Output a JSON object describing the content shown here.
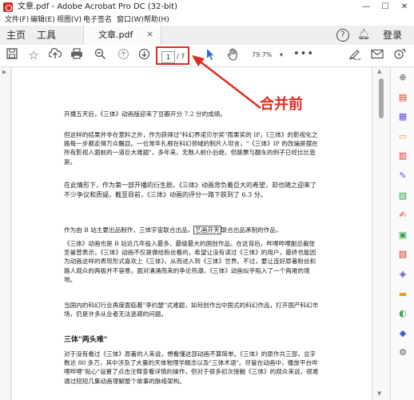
{
  "window": {
    "title": "文章.pdf - Adobe Acrobat Pro DC (32-bit)",
    "minimize": "—",
    "maximize": "☐",
    "close": "✕"
  },
  "menu": [
    "文件(F)",
    "编辑(E)",
    "视图(V)",
    "电子签名",
    "窗口(W)",
    "帮助(H)"
  ],
  "tabs": {
    "home": "主页",
    "tools": "工具",
    "doc": "文章.pdf",
    "close": "×",
    "help": "?",
    "signin": "登录"
  },
  "toolbar": {
    "page_current": "1",
    "page_total": "/ 7",
    "zoom": "79.7%",
    "zoom_caret": "▾",
    "more": "•••",
    "icons": [
      "save-icon",
      "bookmark-star-icon",
      "upload-cloud-icon",
      "print-icon",
      "zoom-out-icon",
      "page-up-icon",
      "page-down-icon",
      "select-cursor-icon",
      "hand-icon",
      "sign-pen-icon",
      "email-icon",
      "share-link-icon"
    ]
  },
  "annotation": {
    "label": "合并前",
    "color": "#e02b20"
  },
  "document": {
    "paragraphs": [
      "开播五天后，《三体》动画版迎来了豆瓣开分 7.2 分的成绩。",
      "但这样的结果并非在意料之外，作为获得过\"科幻界诺贝尔奖\"雨果奖的 IP，《三体》的影视化之路每一步都走得万众瞩目。一位常年扎根在科幻领域的制片人坦言，\"《三体》IP 的改编是摆在所有影视人面前的一道巨大难题\"，多年来，无数人前仆后继，但跳票与翻车的例子已经比比皆是。",
      "在此情形下，作为第一部开播的衍生剧，《三体》动画背负着巨大的希望，却也随之迎来了不少争议和质疑。截至目前，《三体》动画的评分一路下跌到了 6.3 分。",
      "作为由 B 站主要出品制作，三体宇宙联合出品，艺画开天联合出品承制的作品，",
      "《三体》动画也是 B 站近几年投入最多、最级最大的国创作品。在这背后，哔哩哔哩副总裁张圣晏曾表示，《三体》动画不仅是做给粉丝看的，希望让没有读过《三体》的用户，最终也能因为动画这样的表现形式喜欢上《三体》，从而进入到《三体》世界。不过，要让连好原著粉丝和路人观众的两极并不容易，面对涌涌而来的争论热潮，《三体》动画似乎陷入了一个两难的境地。",
      "当国内的科幻行业再度面临着\"李约瑟\"式难题，如何创作出中国式的科幻作品，打开国产科幻市场，仍是许多从业者无法逃避的问题。",
      "对于没有看过《三体》原著的人来说，想看懂这部动画不算简单。《三体》的原作共三部，总字数达 80 多万，其中涉及了大量的天体物理学概念以及\"三体术语\"。尽管在动画中，播放平台哔哩哔哩\"贴心\"设置了点击注释查看详情的操作，但对于很多初次接触《三体》的观众来说，很难通过短短几集动画理解整个故事的脉络架构。"
    ],
    "boxed_phrase": "艺画开天",
    "para4_prefix": "作为由 B 站主要出品制作，三体宇宙联合出品，",
    "para4_suffix": "联合出品承制的作品，",
    "heading": "三体\"两头难\""
  },
  "right_panel": {
    "icons": [
      {
        "name": "search-doc-icon",
        "glyph": "⊕",
        "color": "#5a5a5a"
      },
      {
        "name": "export-pdf-icon",
        "glyph": "▤",
        "color": "#d9362b"
      },
      {
        "name": "create-pdf-icon",
        "glyph": "▦",
        "color": "#6b4fd6"
      },
      {
        "name": "comment-icon",
        "glyph": "▭",
        "color": "#e7a21b"
      },
      {
        "name": "combine-files-icon",
        "glyph": "▥",
        "color": "#d9362b"
      },
      {
        "name": "edit-pdf-icon",
        "glyph": "✎",
        "color": "#6b4fd6"
      },
      {
        "name": "organize-pages-icon",
        "glyph": "▧",
        "color": "#2ba84a"
      },
      {
        "name": "fill-sign-icon",
        "glyph": "✍",
        "color": "#d9362b"
      },
      {
        "name": "send-review-icon",
        "glyph": "▣",
        "color": "#2ba84a"
      },
      {
        "name": "compress-pdf-icon",
        "glyph": "▨",
        "color": "#d9362b"
      },
      {
        "name": "protect-icon",
        "glyph": "◈",
        "color": "#6b4fd6"
      },
      {
        "name": "redact-icon",
        "glyph": "▬",
        "color": "#e7a21b"
      },
      {
        "name": "scan-ocr-icon",
        "glyph": "◐",
        "color": "#2ba84a"
      },
      {
        "name": "shield-icon",
        "glyph": "◆",
        "color": "#3b5fd6"
      },
      {
        "name": "more-tools-icon",
        "glyph": "⚙",
        "color": "#555555"
      }
    ]
  }
}
